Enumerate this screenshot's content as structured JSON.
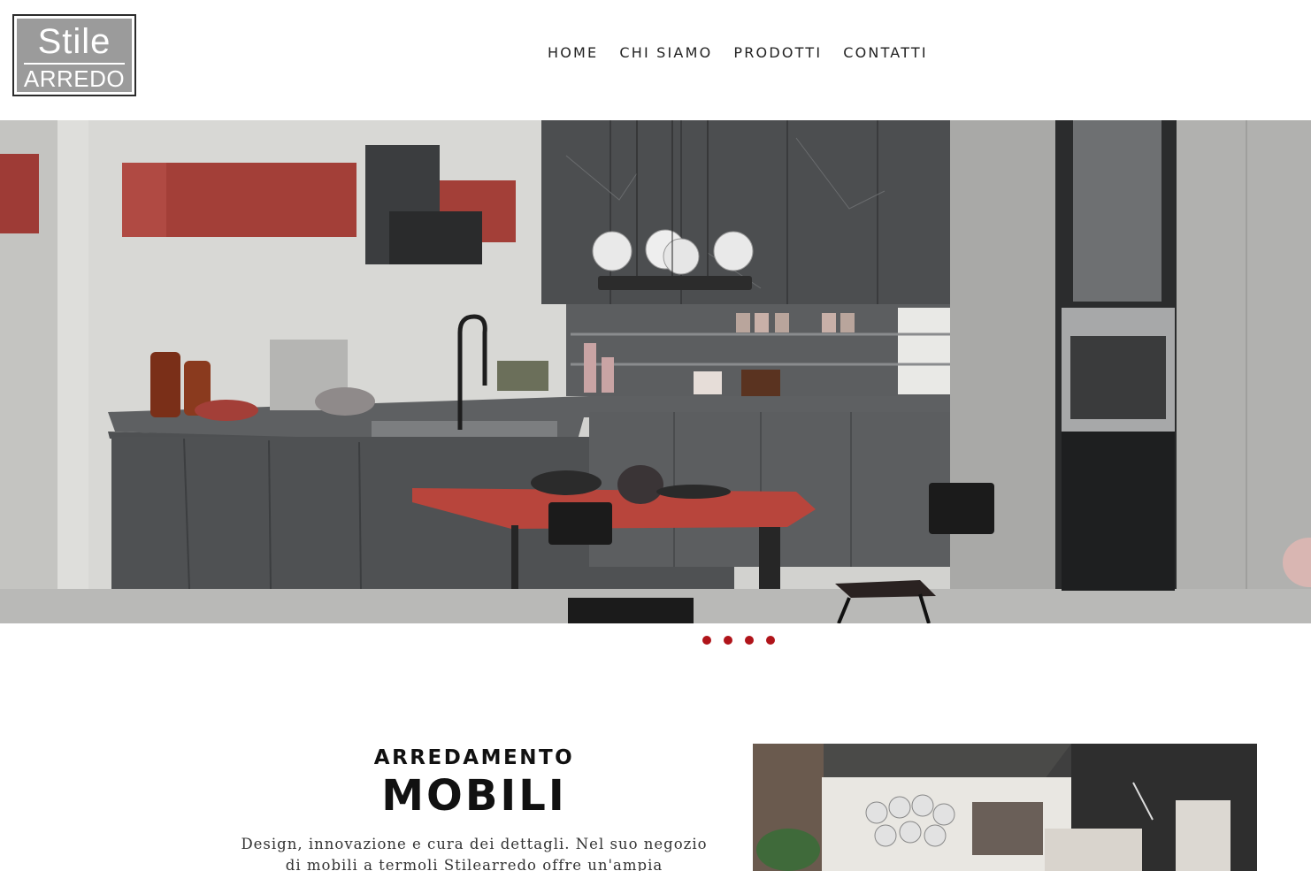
{
  "header": {
    "logo": {
      "top": "Stile",
      "bottom": "ARREDO"
    },
    "nav": [
      {
        "label": "HOME"
      },
      {
        "label": "CHI SIAMO"
      },
      {
        "label": "PRODOTTI"
      },
      {
        "label": "CONTATTI"
      }
    ]
  },
  "hero": {
    "slide_count": 4,
    "dot_color": "#b0141a"
  },
  "intro": {
    "subtitle": "ARREDAMENTO",
    "title": "MOBILI",
    "text": "Design, innovazione e cura dei dettagli. Nel suo negozio di mobili a termoli Stilearredo offre un'ampia esposizione di"
  },
  "colors": {
    "accent": "#b0141a",
    "logo_bg": "#9b9b9b",
    "text": "#111111"
  }
}
